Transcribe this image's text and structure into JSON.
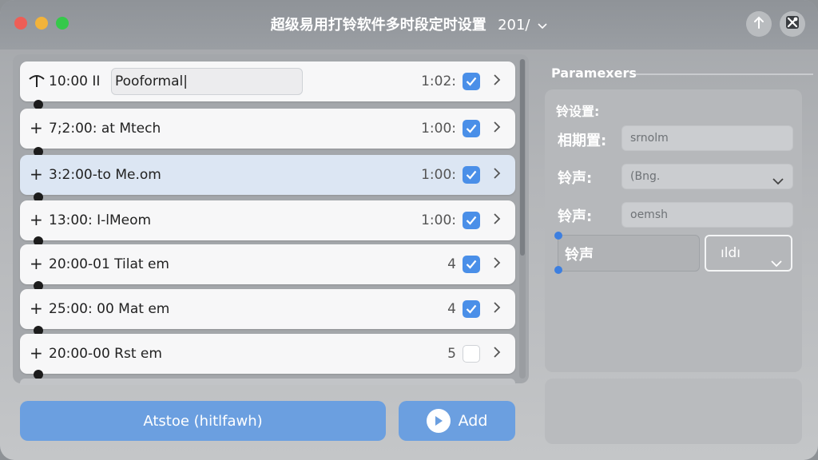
{
  "window": {
    "title": "超级易用打铃软件多时段定时设置",
    "version": "201/"
  },
  "schedule": {
    "rows": [
      {
        "label": "10:00 II",
        "edit_value": "Pooformal|",
        "duration": "1:02:",
        "checked": true
      },
      {
        "label": "7;2:00: at Mtech",
        "duration": "1:00:",
        "checked": true
      },
      {
        "label": "3:2:00-to Me.om",
        "duration": "1:00:",
        "checked": true,
        "highlighted": true
      },
      {
        "label": "13:00: I-lMeom",
        "duration": "1:00:",
        "checked": true
      },
      {
        "label": "20:00-01 Tilat em",
        "duration": "4",
        "checked": true
      },
      {
        "label": "25:00: 00 Mat em",
        "duration": "4",
        "checked": true
      },
      {
        "label": "20:00-00 Rst em",
        "duration": "5",
        "checked": false
      }
    ]
  },
  "actions": {
    "primary_label": "Atstoe (hitlfawh)",
    "add_label": "Add"
  },
  "params": {
    "heading": "Paramexers",
    "section_label": "铃设置:",
    "field1_label": "相期置:",
    "field1_value": "srnolm",
    "field2_label": "铃声:",
    "field2_value": "(Bng.",
    "field3_label": "铃声:",
    "field3_value": "oemsh",
    "group_label": "铃声",
    "group_select_value": "ıldı"
  },
  "colors": {
    "accent": "#4a8fe8",
    "button": "#6b9fe0",
    "highlight_row": "#dce6f3"
  }
}
